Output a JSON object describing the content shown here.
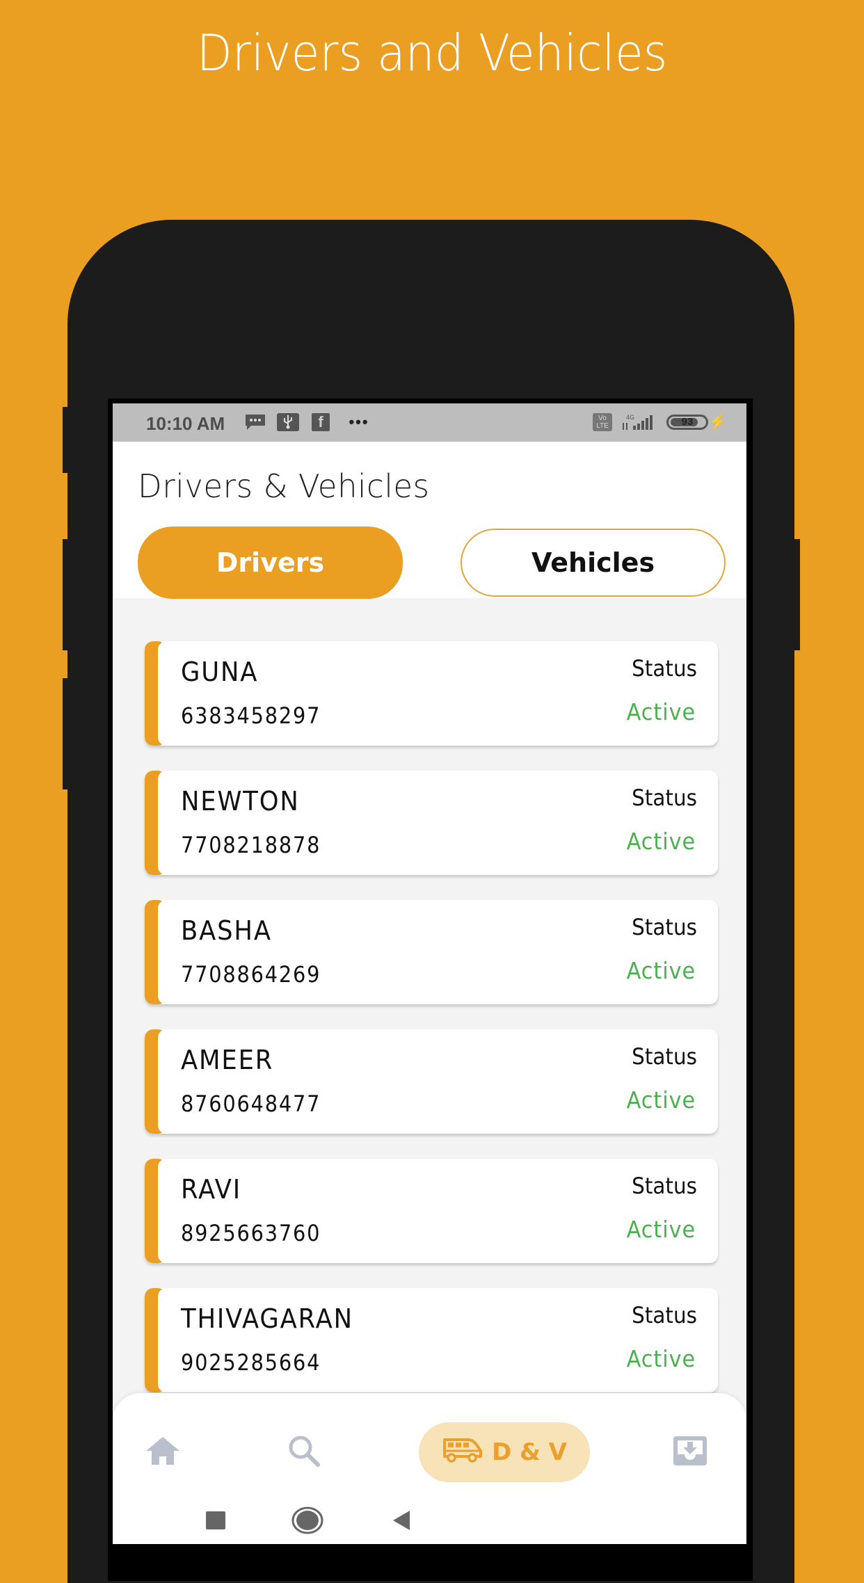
{
  "promo": {
    "title": "Drivers and Vehicles"
  },
  "colors": {
    "accent": "#EB9F22",
    "phone_body": "#1C1C1C",
    "status_active": "#4CAF50",
    "nav_pill_bg": "#F8E2B8",
    "nav_icon_inactive": "#B9BFCB"
  },
  "statusbar": {
    "time": "10:10 AM",
    "left_icons": [
      "message-icon",
      "usb-icon",
      "facebook-icon",
      "more-notifications-icon"
    ],
    "more": "•••",
    "volte": "Vo LTE",
    "network": "4G",
    "battery_level": "93",
    "charging_icon": "⚡"
  },
  "header": {
    "title": "Drivers & Vehicles",
    "tabs": [
      {
        "label": "Drivers",
        "active": true
      },
      {
        "label": "Vehicles",
        "active": false
      }
    ]
  },
  "drivers": [
    {
      "name": "GUNA",
      "phone": "6383458297",
      "status_label": "Status",
      "status": "Active"
    },
    {
      "name": "NEWTON",
      "phone": "7708218878",
      "status_label": "Status",
      "status": "Active"
    },
    {
      "name": "BASHA",
      "phone": "7708864269",
      "status_label": "Status",
      "status": "Active"
    },
    {
      "name": "AMEER",
      "phone": "8760648477",
      "status_label": "Status",
      "status": "Active"
    },
    {
      "name": "RAVI",
      "phone": "8925663760",
      "status_label": "Status",
      "status": "Active"
    },
    {
      "name": "THIVAGARAN",
      "phone": "9025285664",
      "status_label": "Status",
      "status": "Active"
    }
  ],
  "bottom_nav": {
    "items": [
      {
        "icon": "home-icon",
        "label": ""
      },
      {
        "icon": "search-icon",
        "label": ""
      },
      {
        "icon": "van-icon",
        "label": "D & V",
        "active": true
      },
      {
        "icon": "inbox-download-icon",
        "label": ""
      }
    ]
  },
  "system_nav": [
    "recents-square-icon",
    "home-circle-icon",
    "back-triangle-icon"
  ]
}
